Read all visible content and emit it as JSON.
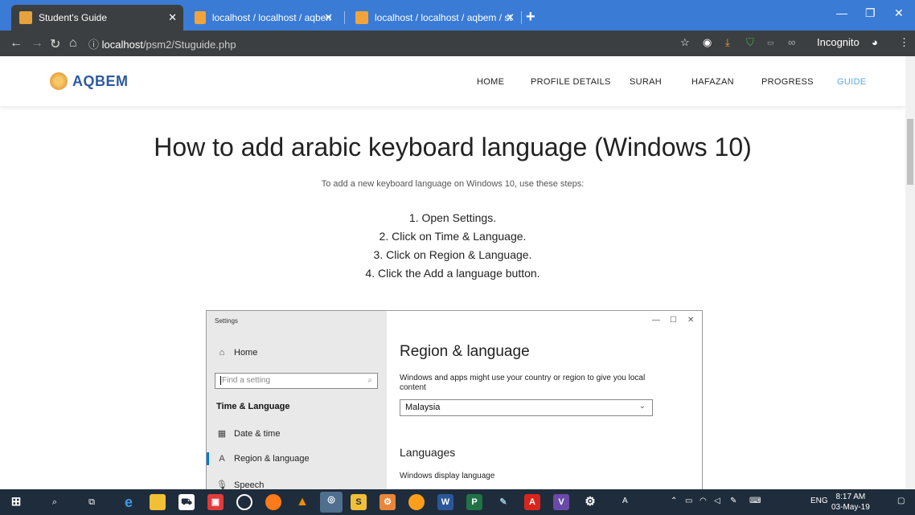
{
  "browser": {
    "tabs": [
      {
        "title": "Student's Guide"
      },
      {
        "title": "localhost / localhost / aqbem / st"
      },
      {
        "title": "localhost / localhost / aqbem / st"
      }
    ],
    "url_host": "localhost",
    "url_path": "/psm2/Stuguide.php",
    "incognito_label": "Incognito"
  },
  "site": {
    "logo_text": "AQBEM",
    "menu": [
      "HOME",
      "PROFILE DETAILS",
      "SURAH",
      "HAFAZAN",
      "PROGRESS",
      "GUIDE"
    ],
    "active_menu": "GUIDE"
  },
  "content": {
    "heading": "How to add arabic keyboard language (Windows 10)",
    "intro": "To add a new keyboard language on Windows 10, use these steps:",
    "steps": [
      "1. Open Settings.",
      "2. Click on Time & Language.",
      "3. Click on Region & Language.",
      "4. Click the Add a language button."
    ]
  },
  "settings_window": {
    "title": "Settings",
    "home": "Home",
    "search_placeholder": "Find a setting",
    "category": "Time & Language",
    "nav_items": [
      "Date & time",
      "Region & language",
      "Speech"
    ],
    "page_title": "Region & language",
    "description": "Windows and apps might use your country or region to give you local content",
    "country_value": "Malaysia",
    "languages_heading": "Languages",
    "display_language_label": "Windows display language"
  },
  "taskbar": {
    "lang": "ENG",
    "time": "8:17 AM",
    "date": "03-May-19"
  }
}
